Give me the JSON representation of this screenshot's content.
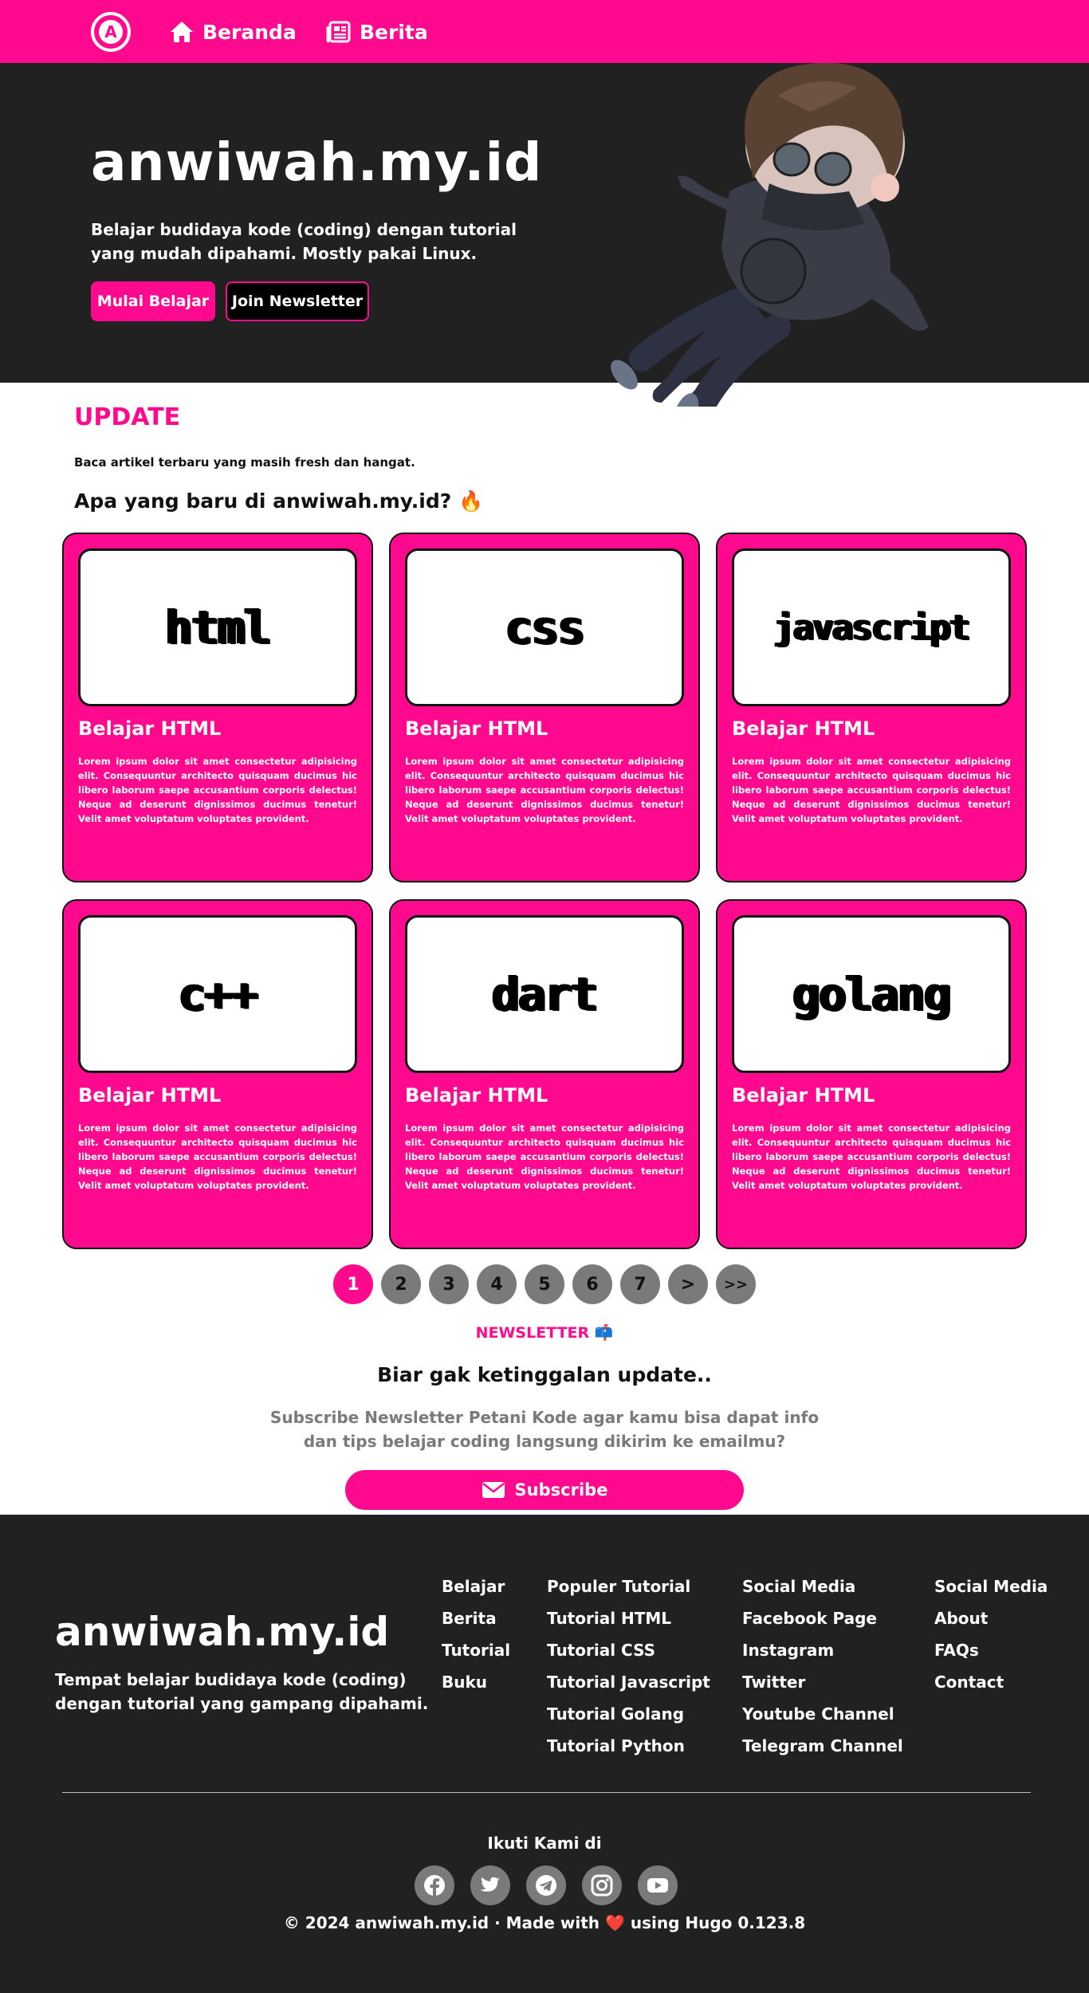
{
  "nav": {
    "logo_letter": "A",
    "home_label": "Beranda",
    "news_label": "Berita"
  },
  "hero": {
    "title": "anwiwah.my.id",
    "description": "Belajar budidaya kode (coding) dengan tutorial yang mudah dipahami. Mostly pakai Linux.",
    "primary_button": "Mulai Belajar",
    "secondary_button": "Join Newsletter"
  },
  "update": {
    "heading": "UPDATE",
    "subtitle": "Baca artikel terbaru yang masih fresh dan hangat.",
    "question": "Apa yang baru di anwiwah.my.id?",
    "question_emoji": "🔥",
    "cards": [
      {
        "image_label": "html",
        "title": "Belajar HTML",
        "text": "Lorem ipsum dolor sit amet consectetur adipisicing elit. Consequuntur architecto quisquam ducimus hic libero laborum saepe accusantium corporis delectus! Neque ad deserunt dignissimos ducimus tenetur! Velit amet voluptatum voluptates provident."
      },
      {
        "image_label": "css",
        "title": "Belajar HTML",
        "text": "Lorem ipsum dolor sit amet consectetur adipisicing elit. Consequuntur architecto quisquam ducimus hic libero laborum saepe accusantium corporis delectus! Neque ad deserunt dignissimos ducimus tenetur! Velit amet voluptatum voluptates provident."
      },
      {
        "image_label": "javascript",
        "title": "Belajar HTML",
        "text": "Lorem ipsum dolor sit amet consectetur adipisicing elit. Consequuntur architecto quisquam ducimus hic libero laborum saepe accusantium corporis delectus! Neque ad deserunt dignissimos ducimus tenetur! Velit amet voluptatum voluptates provident."
      },
      {
        "image_label": "c++",
        "title": "Belajar HTML",
        "text": "Lorem ipsum dolor sit amet consectetur adipisicing elit. Consequuntur architecto quisquam ducimus hic libero laborum saepe accusantium corporis delectus! Neque ad deserunt dignissimos ducimus tenetur! Velit amet voluptatum voluptates provident."
      },
      {
        "image_label": "dart",
        "title": "Belajar HTML",
        "text": "Lorem ipsum dolor sit amet consectetur adipisicing elit. Consequuntur architecto quisquam ducimus hic libero laborum saepe accusantium corporis delectus! Neque ad deserunt dignissimos ducimus tenetur! Velit amet voluptatum voluptates provident."
      },
      {
        "image_label": "golang",
        "title": "Belajar HTML",
        "text": "Lorem ipsum dolor sit amet consectetur adipisicing elit. Consequuntur architecto quisquam ducimus hic libero laborum saepe accusantium corporis delectus! Neque ad deserunt dignissimos ducimus tenetur! Velit amet voluptatum voluptates provident."
      }
    ]
  },
  "pagination": {
    "pages": [
      "1",
      "2",
      "3",
      "4",
      "5",
      "6",
      "7",
      ">",
      ">>"
    ],
    "active": "1"
  },
  "newsletter": {
    "tag": "NEWSLETTER",
    "tag_emoji": "📫",
    "title": "Biar gak ketinggalan update..",
    "description": "Subscribe Newsletter Petani Kode agar kamu bisa dapat info dan tips belajar coding langsung dikirim ke emailmu?",
    "button": "Subscribe"
  },
  "footer": {
    "title": "anwiwah.my.id",
    "description": "Tempat belajar budidaya kode (coding) dengan tutorial yang gampang dipahami.",
    "col1": [
      "Belajar",
      "Berita",
      "Tutorial",
      "Buku"
    ],
    "col2": [
      "Populer Tutorial",
      "Tutorial HTML",
      "Tutorial CSS",
      "Tutorial Javascript",
      "Tutorial Golang",
      "Tutorial Python"
    ],
    "col3": [
      "Social Media",
      "Facebook Page",
      "Instagram",
      "Twitter",
      "Youtube Channel",
      "Telegram Channel"
    ],
    "col4": [
      "Social Media",
      "About",
      "FAQs",
      "Contact"
    ],
    "follow": "Ikuti Kami di",
    "socials": [
      "facebook-icon",
      "twitter-icon",
      "telegram-icon",
      "instagram-icon",
      "youtube-icon"
    ],
    "copyright_prefix": "© 2024 anwiwah.my.id · Made with",
    "heart": "❤️",
    "copyright_suffix": "using Hugo 0.123.8"
  },
  "colors": {
    "accent": "#ff0a8f",
    "dark": "#212121",
    "muted": "#7a7a7a"
  }
}
